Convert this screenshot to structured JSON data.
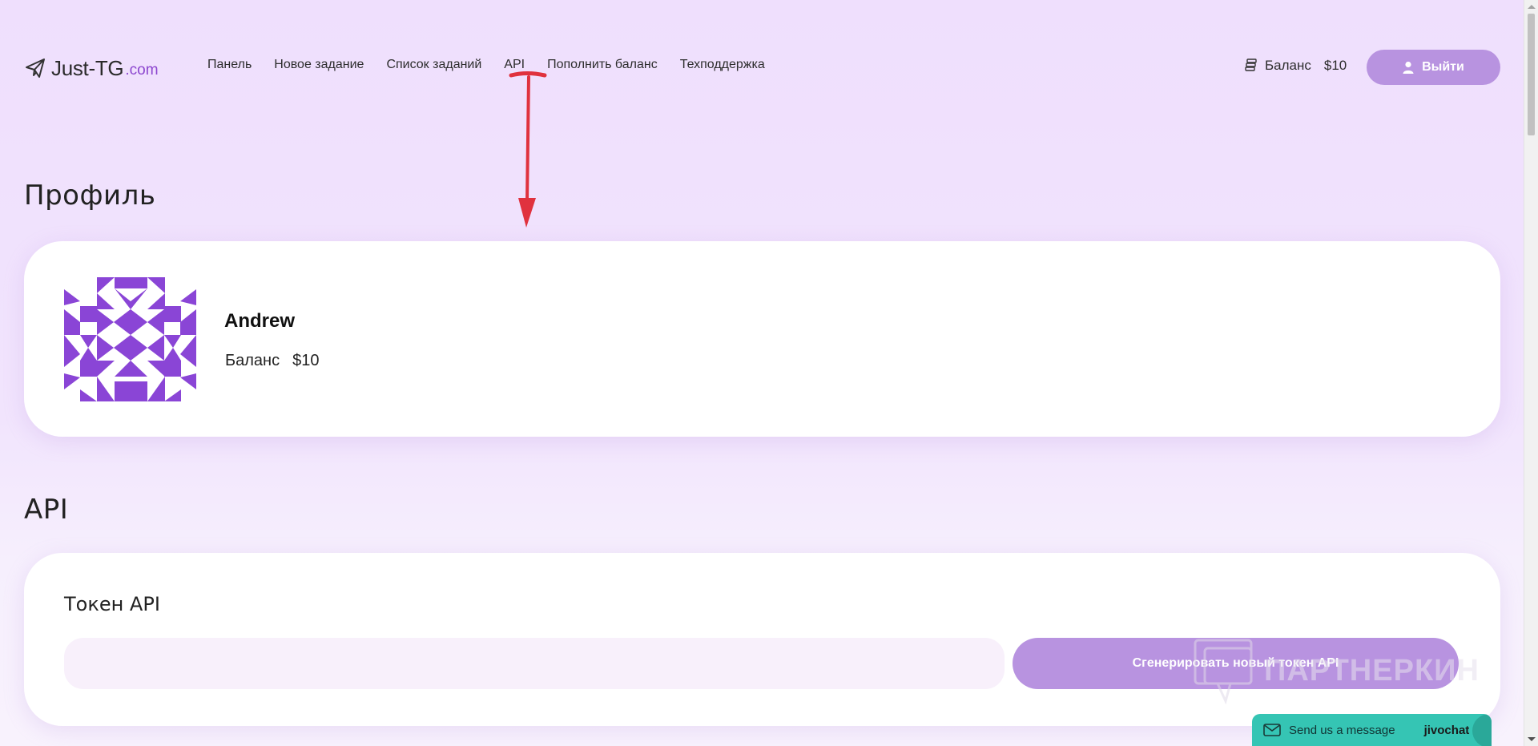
{
  "header": {
    "logo": {
      "name": "Just-TG",
      "tld": ".com"
    },
    "nav": [
      {
        "label": "Панель"
      },
      {
        "label": "Новое задание"
      },
      {
        "label": "Список заданий"
      },
      {
        "label": "API"
      },
      {
        "label": "Пополнить баланс"
      },
      {
        "label": "Техподдержка"
      }
    ],
    "balance": {
      "label": "Баланс",
      "amount": "$10"
    },
    "logout_label": "Выйти"
  },
  "profile": {
    "title": "Профиль",
    "user_name": "Andrew",
    "balance_label": "Баланс",
    "balance_amount": "$10"
  },
  "api": {
    "title": "API",
    "token_label": "Токен API",
    "token_value": "",
    "generate_label": "Сгенерировать новый токен API"
  },
  "watermark": {
    "text": "ПАРТНЕРКИН"
  },
  "chat_widget": {
    "label": "Send us a message",
    "brand": "jivochat"
  },
  "colors": {
    "accent": "#b893e0",
    "brand_purple": "#8c46cf",
    "avatar_purple": "#8a45d6",
    "annotation_red": "#e0323e",
    "chat_teal": "#35c5b4"
  }
}
